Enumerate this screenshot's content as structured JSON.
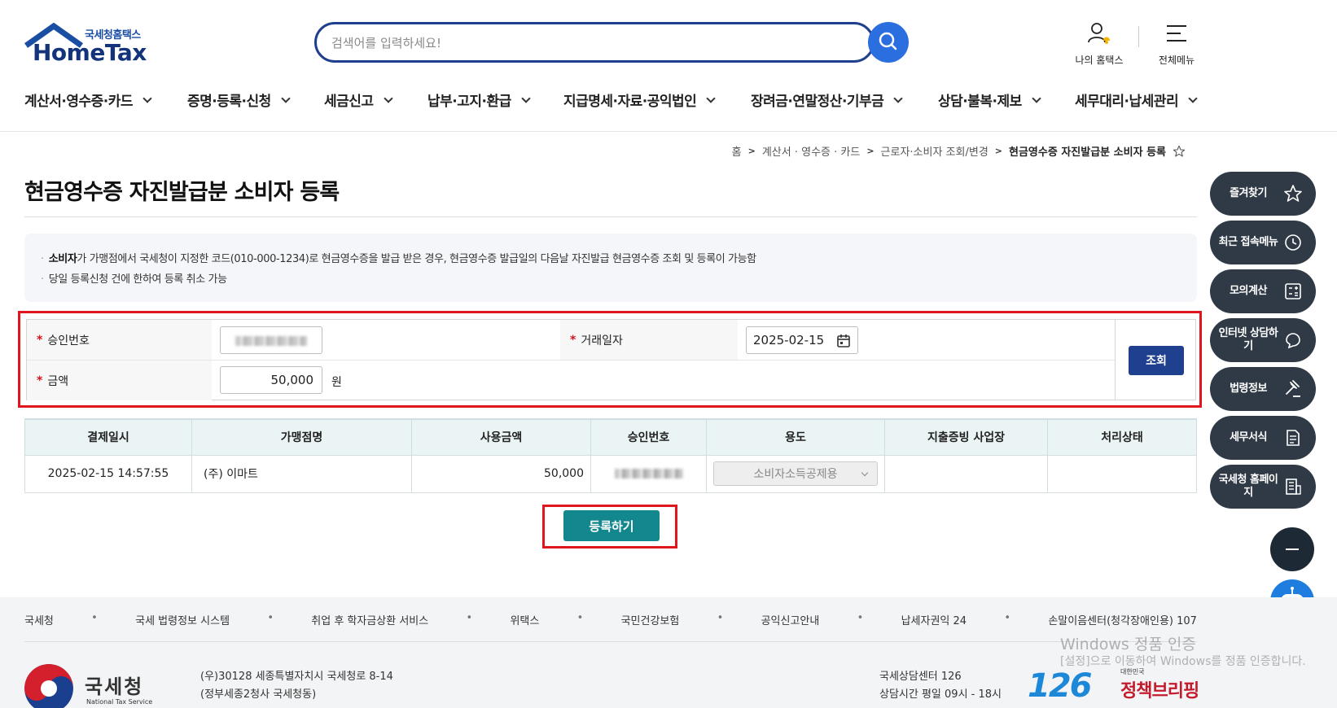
{
  "header": {
    "logo_sub": "국세청홈택스",
    "logo_main": "HomeTax",
    "search_placeholder": "검색어를 입력하세요!",
    "my_hometax": "나의 홈택스",
    "all_menu": "전체메뉴"
  },
  "gnb": [
    {
      "label": "계산서·영수증·카드"
    },
    {
      "label": "증명·등록·신청"
    },
    {
      "label": "세금신고"
    },
    {
      "label": "납부·고지·환급"
    },
    {
      "label": "지급명세·자료·공익법인"
    },
    {
      "label": "장려금·연말정산·기부금"
    },
    {
      "label": "상담·불복·제보"
    },
    {
      "label": "세무대리·납세관리"
    }
  ],
  "breadcrumb": {
    "home": "홈",
    "level1": "계산서 · 영수증 · 카드",
    "level2": "근로자·소비자 조회/변경",
    "current": "현금영수증 자진발급분 소비자 등록"
  },
  "page_title": "현금영수증 자진발급분 소비자 등록",
  "notice": {
    "line1_bold": "소비자",
    "line1_rest": "가 가맹점에서 국세청이 지정한 코드(010-000-1234)로 현금영수증을 발급 받은 경우, 현금영수증 발급일의 다음날 자진발급 현금영수증 조회 및 등록이 가능함",
    "line2": "당일 등록신청 건에 한하여 등록 취소 가능"
  },
  "form": {
    "approval_label": "승인번호",
    "date_label": "거래일자",
    "date_value": "2025-02-15",
    "amount_label": "금액",
    "amount_value": "50,000",
    "amount_unit": "원",
    "required_mark": "*",
    "search_button": "조회"
  },
  "results": {
    "headers": [
      "결제일시",
      "가맹점명",
      "사용금액",
      "승인번호",
      "용도",
      "지출증빙 사업장",
      "처리상태"
    ],
    "rows": [
      {
        "datetime": "2025-02-15 14:57:55",
        "merchant": "(주) 이마트",
        "amount": "50,000",
        "purpose": "소비자소득공제용",
        "business": "",
        "status": ""
      }
    ]
  },
  "submit_button": "등록하기",
  "quick_menu": [
    {
      "label": "즐겨찾기",
      "icon": "star-icon"
    },
    {
      "label": "최근 접속메뉴",
      "icon": "clock-icon"
    },
    {
      "label": "모의계산",
      "icon": "calculator-icon"
    },
    {
      "label": "인터넷 상담하기",
      "icon": "chat-bubble-icon"
    },
    {
      "label": "법령정보",
      "icon": "gavel-icon"
    },
    {
      "label": "세무서식",
      "icon": "document-icon"
    },
    {
      "label": "국세청 홈페이지",
      "icon": "building-icon"
    }
  ],
  "footer": {
    "links": [
      "국세청",
      "국세 법령정보 시스템",
      "취업 후 학자금상환 서비스",
      "위택스",
      "국민건강보험",
      "공익신고안내",
      "납세자권익 24",
      "손말이음센터(청각장애인용) 107"
    ],
    "org_name": "국세청",
    "org_name_en": "National Tax Service",
    "address1": "(우)30128 세종특별자치시 국세청로 8-14",
    "address2": "(정부세종2청사 국세청동)",
    "center_name": "국세상담센터 126",
    "center_hours": "상담시간 평일 09시 - 18시",
    "logo_126": "126",
    "policy_small": "대한민국",
    "policy_big": "정책브리핑"
  },
  "watermark": {
    "line1": "Windows 정품 인증",
    "line2": "[설정]으로 이동하여 Windows를 정품 인증합니다."
  },
  "colors": {
    "brand_navy": "#1f3f8f",
    "search_blue": "#2b6ee0",
    "submit_teal": "#12878e",
    "highlight_red": "#e0161f",
    "table_header_bg": "#eaf4f5",
    "quick_menu_bg": "#2f3a46"
  }
}
